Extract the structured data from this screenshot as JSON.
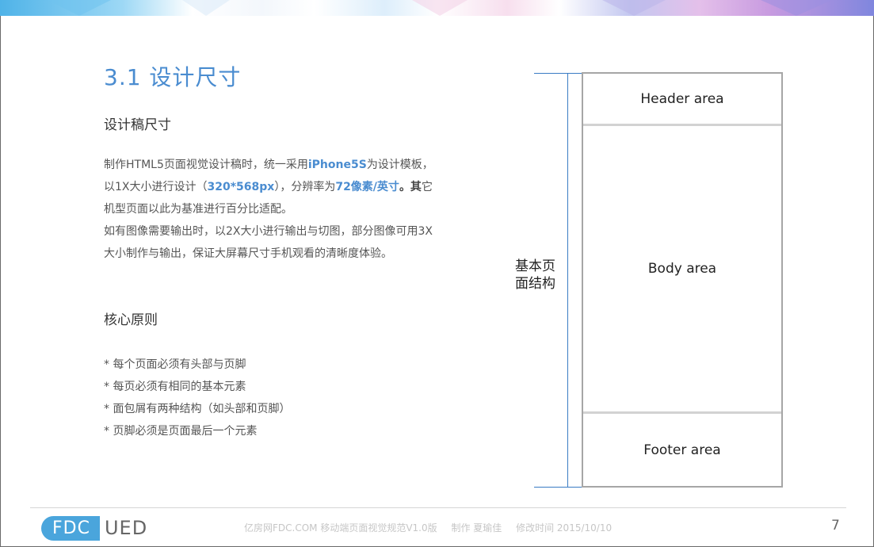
{
  "slide": {
    "title": "3.1 设计尺寸",
    "page_number": "7"
  },
  "design_size": {
    "heading": "设计稿尺寸",
    "p1_a": "制作HTML5页面视觉设计稿时，统一采用",
    "p1_b": "iPhone5S",
    "p1_c": "为设计模板，以1X大小进行设计（",
    "p1_d": "320*568px",
    "p1_e": "），分辨率为",
    "p1_f": "72像素/英寸",
    "p1_g": "。其",
    "p1_h": "它机型页面以此为基准进行百分比适配。",
    "p2": "如有图像需要输出时，以2X大小进行输出与切图，部分图像可用3X大小制作与输出，保证大屏幕尺寸手机观看的清晰度体验。"
  },
  "principles": {
    "heading": "核心原则",
    "items": [
      "* 每个页面必须有头部与页脚",
      "* 每页必须有相同的基本元素",
      "* 面包屑有两种结构（如头部和页脚）",
      "* 页脚必须是页面最后一个元素"
    ]
  },
  "diagram": {
    "dimension_label": "基本页面结构",
    "header_area": "Header area",
    "body_area": "Body area",
    "footer_area": "Footer area"
  },
  "footer": {
    "logo_left": "FDC",
    "logo_right": "UED",
    "site": "亿房网FDC.COM 移动端页面视觉规范V1.0版",
    "author": "制作 夏瑜佳",
    "date": "修改时间 2015/10/10"
  },
  "colors": {
    "accent": "#4a8cd0",
    "logo_blue": "#4aa5dc"
  }
}
